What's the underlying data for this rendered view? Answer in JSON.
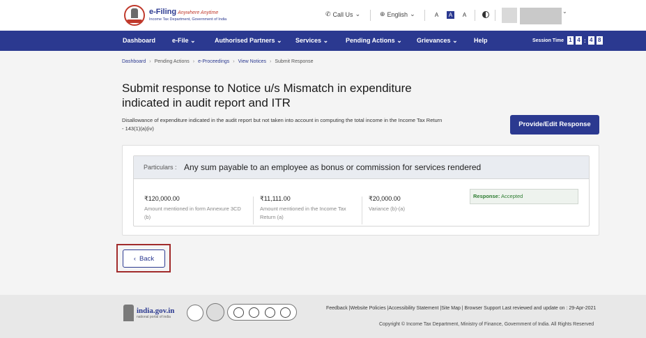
{
  "header": {
    "logo_title": "e-Filing",
    "logo_tagline": "Anywhere Anytime",
    "logo_subtitle": "Income Tax Department, Government of India",
    "call_us": "Call Us",
    "language": "English",
    "font_decrease": "A",
    "font_normal": "A",
    "font_increase": "A"
  },
  "nav": {
    "items": [
      "Dashboard",
      "e-File",
      "Authorised Partners",
      "Services",
      "Pending Actions",
      "Grievances",
      "Help"
    ],
    "session_label": "Session Time",
    "session_digits": [
      "1",
      "4",
      "4",
      "8"
    ]
  },
  "breadcrumb": [
    "Dashboard",
    "Pending Actions",
    "e-Proceedings",
    "View Notices",
    "Submit Response"
  ],
  "page": {
    "title": "Submit response to Notice u/s Mismatch in expenditure indicated in audit report and ITR",
    "description": "Disallowance of expenditure indicated in the audit report but not taken into account in computing the total income in the Income Tax Return - 143(1)(a)(iv)",
    "primary_button": "Provide/Edit Response"
  },
  "card": {
    "particulars_label": "Particulars :",
    "particulars_value": "Any sum payable to an employee as bonus or commission for services rendered",
    "columns": [
      {
        "amount": "₹120,000.00",
        "caption": "Amount mentioned in form Annexure 3CD (b)"
      },
      {
        "amount": "₹11,111.00",
        "caption": "Amount mentioned in the Income Tax Return (a)"
      },
      {
        "amount": "₹20,000.00",
        "caption": "Variance (b)-(a)"
      }
    ],
    "response_label": "Response:",
    "response_value": "Accepted"
  },
  "back_button": "Back",
  "footer": {
    "india_title": "india.gov.in",
    "india_sub": "national portal of india",
    "links": "Feedback |Website Policies |Accessibility Statement |Site Map | Browser Support  Last reviewed and update on : 29-Apr-2021",
    "copyright": "Copyright © Income Tax Department, Ministry of Finance, Government of India. All Rights Reserved"
  },
  "colors": {
    "primary": "#2b3990",
    "accent_red": "#a12b2b",
    "success": "#2e7d32"
  }
}
